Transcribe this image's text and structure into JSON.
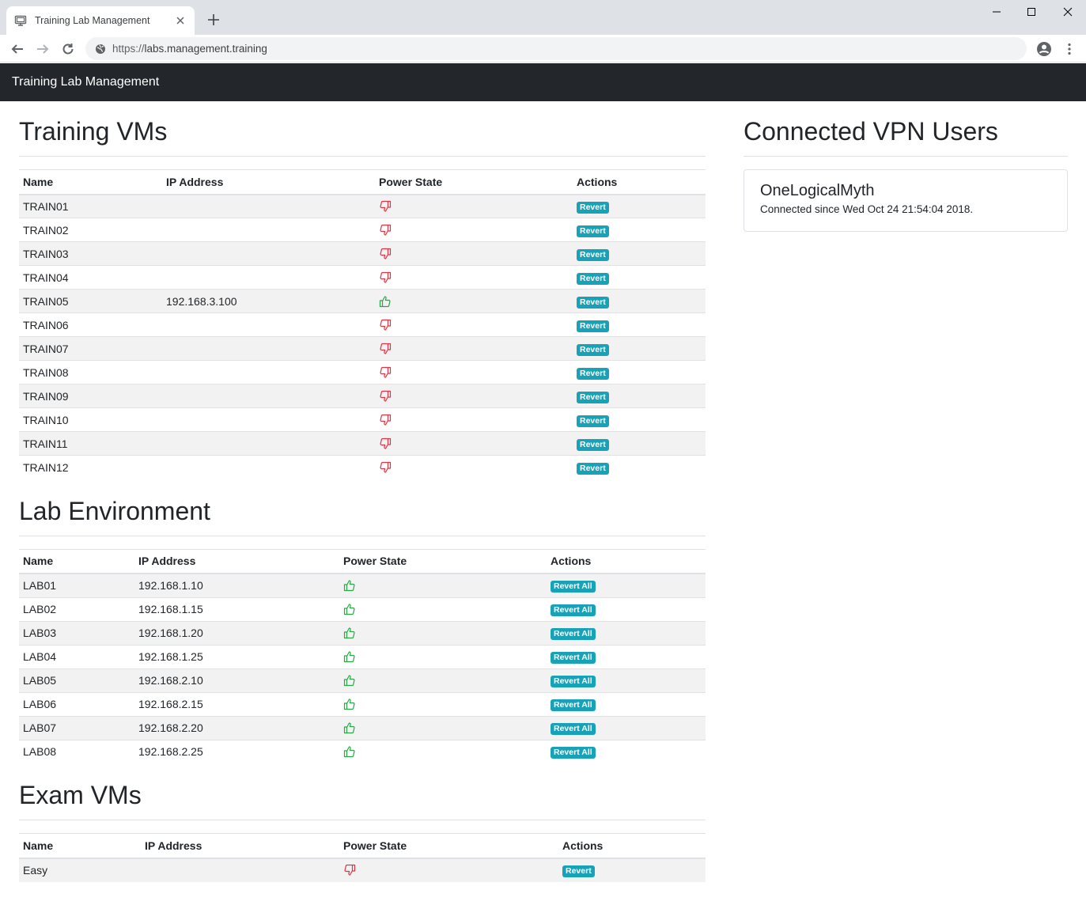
{
  "browser": {
    "tab_title": "Training Lab Management",
    "url_scheme": "https://",
    "url_host": "labs.management.training"
  },
  "navbar": {
    "brand": "Training Lab Management"
  },
  "training": {
    "title": "Training VMs",
    "columns": [
      "Name",
      "IP Address",
      "Power State",
      "Actions"
    ],
    "rows": [
      {
        "name": "TRAIN01",
        "ip": "",
        "power": "off",
        "action": "Revert"
      },
      {
        "name": "TRAIN02",
        "ip": "",
        "power": "off",
        "action": "Revert"
      },
      {
        "name": "TRAIN03",
        "ip": "",
        "power": "off",
        "action": "Revert"
      },
      {
        "name": "TRAIN04",
        "ip": "",
        "power": "off",
        "action": "Revert"
      },
      {
        "name": "TRAIN05",
        "ip": "192.168.3.100",
        "power": "on",
        "action": "Revert"
      },
      {
        "name": "TRAIN06",
        "ip": "",
        "power": "off",
        "action": "Revert"
      },
      {
        "name": "TRAIN07",
        "ip": "",
        "power": "off",
        "action": "Revert"
      },
      {
        "name": "TRAIN08",
        "ip": "",
        "power": "off",
        "action": "Revert"
      },
      {
        "name": "TRAIN09",
        "ip": "",
        "power": "off",
        "action": "Revert"
      },
      {
        "name": "TRAIN10",
        "ip": "",
        "power": "off",
        "action": "Revert"
      },
      {
        "name": "TRAIN11",
        "ip": "",
        "power": "off",
        "action": "Revert"
      },
      {
        "name": "TRAIN12",
        "ip": "",
        "power": "off",
        "action": "Revert"
      }
    ]
  },
  "lab": {
    "title": "Lab Environment",
    "columns": [
      "Name",
      "IP Address",
      "Power State",
      "Actions"
    ],
    "rows": [
      {
        "name": "LAB01",
        "ip": "192.168.1.10",
        "power": "on",
        "action": "Revert All"
      },
      {
        "name": "LAB02",
        "ip": "192.168.1.15",
        "power": "on",
        "action": "Revert All"
      },
      {
        "name": "LAB03",
        "ip": "192.168.1.20",
        "power": "on",
        "action": "Revert All"
      },
      {
        "name": "LAB04",
        "ip": "192.168.1.25",
        "power": "on",
        "action": "Revert All"
      },
      {
        "name": "LAB05",
        "ip": "192.168.2.10",
        "power": "on",
        "action": "Revert All"
      },
      {
        "name": "LAB06",
        "ip": "192.168.2.15",
        "power": "on",
        "action": "Revert All"
      },
      {
        "name": "LAB07",
        "ip": "192.168.2.20",
        "power": "on",
        "action": "Revert All"
      },
      {
        "name": "LAB08",
        "ip": "192.168.2.25",
        "power": "on",
        "action": "Revert All"
      }
    ]
  },
  "exam": {
    "title": "Exam VMs",
    "columns": [
      "Name",
      "IP Address",
      "Power State",
      "Actions"
    ],
    "rows": [
      {
        "name": "Easy",
        "ip": "",
        "power": "off",
        "action": "Revert"
      }
    ]
  },
  "vpn": {
    "title": "Connected VPN Users",
    "users": [
      {
        "name": "OneLogicalMyth",
        "since": "Connected since Wed Oct 24 21:54:04 2018."
      }
    ]
  },
  "colors": {
    "power_on": "#28a745",
    "power_off": "#dc3545",
    "badge": "#17a2b8",
    "navbar": "#23272b"
  },
  "icons": {
    "power_on": "thumbs-up-icon",
    "power_off": "thumbs-down-icon"
  }
}
